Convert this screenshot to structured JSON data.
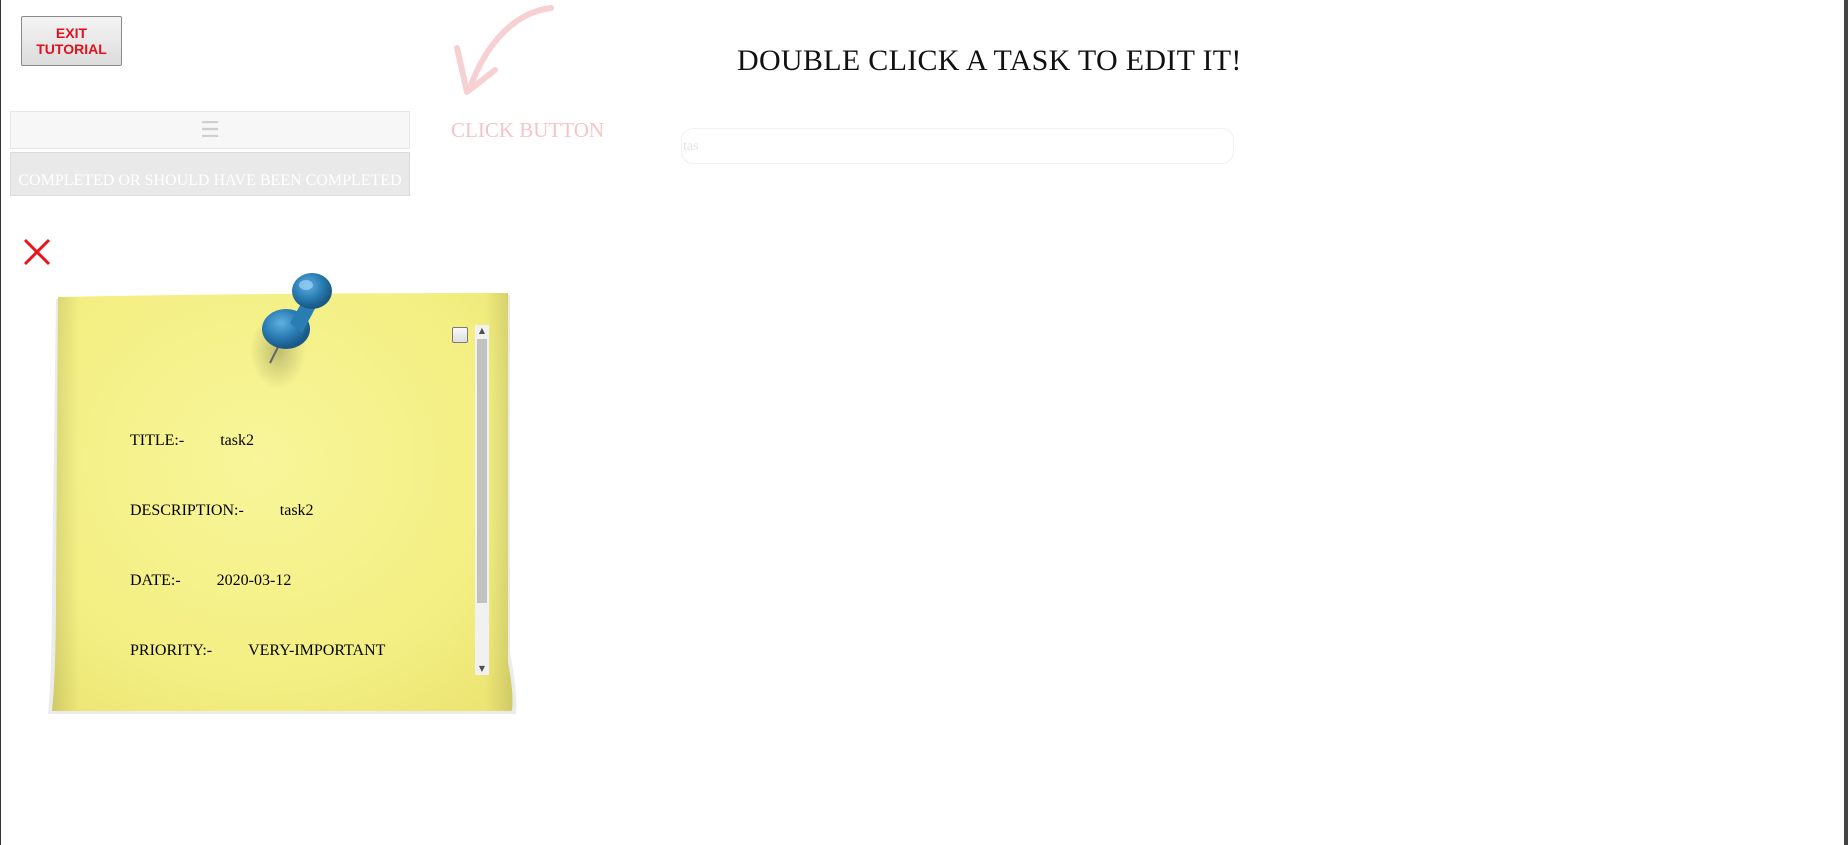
{
  "exit_button": {
    "label": "EXIT\nTUTORIAL"
  },
  "headline": "DOUBLE CLICK A TASK TO EDIT IT!",
  "tutorial": {
    "hint": "CLICK BUTTON",
    "hint_color": "#f5c4c8"
  },
  "menu_bar": {
    "icon": "menu-icon",
    "glyph": "☰"
  },
  "tabs": {
    "completed": "COMPLETED OR SHOULD HAVE BEEN COMPLETED"
  },
  "search": {
    "value": "tas"
  },
  "task_note": {
    "checked": false,
    "color": "#f5f28a",
    "pin_color": "#2a7db3",
    "fields": [
      {
        "label": "TITLE:-",
        "value": "task2"
      },
      {
        "label": "DESCRIPTION:-",
        "value": "task2"
      },
      {
        "label": "DATE:-",
        "value": "2020-03-12"
      },
      {
        "label": "PRIORITY:-",
        "value": "VERY-IMPORTANT"
      }
    ]
  },
  "close_icon": {
    "name": "close-icon",
    "color": "#e8141b"
  }
}
